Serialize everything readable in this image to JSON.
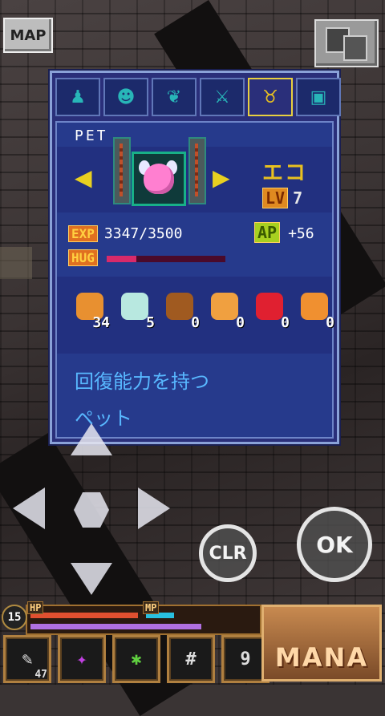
{
  "top_buttons": {
    "map_label": "MAP",
    "save_icon": "floppy-disk-icon"
  },
  "tabs": [
    {
      "icon": "person-icon",
      "glyph": "♟"
    },
    {
      "icon": "armor-icon",
      "glyph": "☻"
    },
    {
      "icon": "ring-icon",
      "glyph": "❦"
    },
    {
      "icon": "sword-icon",
      "glyph": "⚔"
    },
    {
      "icon": "pet-icon",
      "glyph": "♉",
      "active": true
    },
    {
      "icon": "monitor-icon",
      "glyph": "▣"
    }
  ],
  "pet": {
    "section_label": "PET",
    "name": "エコ",
    "lv_label": "LV",
    "level": "7",
    "exp_label": "EXP",
    "exp": "3347/3500",
    "ap_label": "AP",
    "ap": "+56",
    "hug_label": "HUG",
    "hug_fraction": 0.25,
    "description_line1": "回復能力を持つ",
    "description_line2": "ペット"
  },
  "food_items": [
    {
      "icon": "bread-icon",
      "count": "34",
      "color": "#e89030"
    },
    {
      "icon": "crystal-icon",
      "count": "5",
      "color": "#b8e8e0"
    },
    {
      "icon": "meat-icon",
      "count": "0",
      "color": "#a05a20"
    },
    {
      "icon": "lollipop-icon",
      "count": "0",
      "color": "#f0a040"
    },
    {
      "icon": "apple-icon",
      "count": "0",
      "color": "#e02030"
    },
    {
      "icon": "parfait-icon",
      "count": "0",
      "color": "#f09030"
    }
  ],
  "controls": {
    "clr_label": "CLR",
    "ok_label": "OK"
  },
  "hud": {
    "level": "15",
    "hp_label": "HP",
    "mp_label": "MP",
    "hp_fraction": 0.96,
    "mp_fraction": 0.25,
    "xp_fraction": 0.76,
    "slots": [
      {
        "icon": "scroll-icon",
        "count": "47"
      },
      {
        "icon": "rune-icon",
        "count": ""
      },
      {
        "icon": "swirl-icon",
        "count": ""
      },
      {
        "icon": "hash-slot-icon",
        "glyph": "#",
        "count": ""
      },
      {
        "icon": "nine-slot-icon",
        "glyph": "9",
        "count": ""
      }
    ],
    "mana_label": "MANA"
  }
}
